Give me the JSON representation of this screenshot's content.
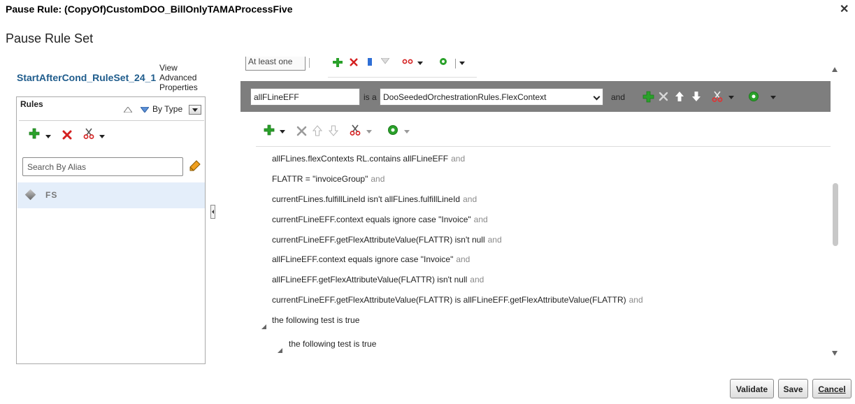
{
  "dialog": {
    "title": "Pause Rule: (CopyOf)CustomDOO_BillOnlyTAMAProcessFive",
    "close_glyph": "✕"
  },
  "section_title": "Pause Rule Set",
  "ruleset": {
    "name": "StartAfterCond_RuleSet_24_1",
    "view_advanced": "View Advanced Properties"
  },
  "rules_panel": {
    "label": "Rules",
    "sort_label": "By Type",
    "search_placeholder": "Search By Alias",
    "items": [
      {
        "label": "FS"
      }
    ]
  },
  "top_toolbar": {
    "quantifier": "At least one"
  },
  "variable": {
    "name": "allFLineEFF",
    "isa": "is a",
    "type": "DooSeededOrchestrationRules.FlexContext",
    "and": "and"
  },
  "conditions": [
    {
      "text": "allFLines.flexContexts RL.contains allFLineEFF",
      "and": "and"
    },
    {
      "text": "FLATTR = \"invoiceGroup\"",
      "and": "and"
    },
    {
      "text": "currentFLines.fulfillLineId isn't allFLines.fulfillLineId",
      "and": "and"
    },
    {
      "text": "currentFLineEFF.context equals ignore case \"Invoice\"",
      "and": "and"
    },
    {
      "text": "currentFLineEFF.getFlexAttributeValue(FLATTR) isn't null",
      "and": "and"
    },
    {
      "text": "allFLineEFF.context equals ignore case \"Invoice\"",
      "and": "and"
    },
    {
      "text": "allFLineEFF.getFlexAttributeValue(FLATTR) isn't null",
      "and": "and"
    },
    {
      "text": "currentFLineEFF.getFlexAttributeValue(FLATTR) is allFLineEFF.getFlexAttributeValue(FLATTR)",
      "and": "and"
    }
  ],
  "nested_tests": [
    {
      "text": "the following test is true"
    },
    {
      "text": "the following test is true"
    }
  ],
  "footer": {
    "validate": "Validate",
    "save": "Save",
    "cancel": "Cancel"
  },
  "colors": {
    "accent": "#1f5c8c",
    "green": "#2aa12a",
    "red": "#d42020",
    "bar": "#7e7e7e"
  },
  "icons": [
    "add-icon",
    "delete-icon",
    "cut-icon",
    "settings-icon",
    "arrow-up-icon",
    "arrow-down-icon",
    "eraser-icon",
    "diamond-icon"
  ]
}
